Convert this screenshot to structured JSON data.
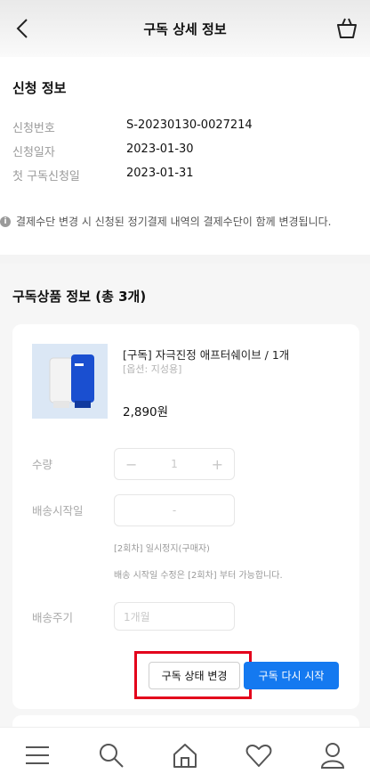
{
  "header": {
    "title": "구독 상세 정보",
    "back_icon": "chevron-left-icon",
    "cart_icon": "shopping-bag-icon"
  },
  "application": {
    "title": "신청 정보",
    "rows": [
      {
        "label": "신청번호",
        "value": "S-20230130-0027214"
      },
      {
        "label": "신청일자",
        "value": "2023-01-30"
      },
      {
        "label": "첫 구독신청일",
        "value": "2023-01-31"
      }
    ],
    "notice": "결제수단 변경 시 신청된 정기결제 내역의 결제수단이 함께 변경됩니다."
  },
  "products": {
    "title": "구독상품 정보 (총 3개)",
    "item": {
      "name": "[구독] 자극진정 애프터쉐이브 / 1개",
      "option": "[옵션: 지성용]",
      "price": "2,890원"
    },
    "quantity_label": "수량",
    "quantity_value": "1",
    "start_label": "배송시작일",
    "start_value": "-",
    "pause_note": "[2회차] 일시정지(구매자)",
    "edit_note": "배송 시작일 수정은 [2회차] 부터 가능합니다.",
    "cycle_label": "배송주기",
    "cycle_value": "1개월",
    "change_button": "구독 상태 변경",
    "restart_button": "구독 다시 시작"
  },
  "tabbar": [
    "menu-icon",
    "search-icon",
    "home-icon",
    "heart-icon",
    "user-icon"
  ],
  "colors": {
    "accent": "#1479f0",
    "highlight": "#e3001b"
  }
}
